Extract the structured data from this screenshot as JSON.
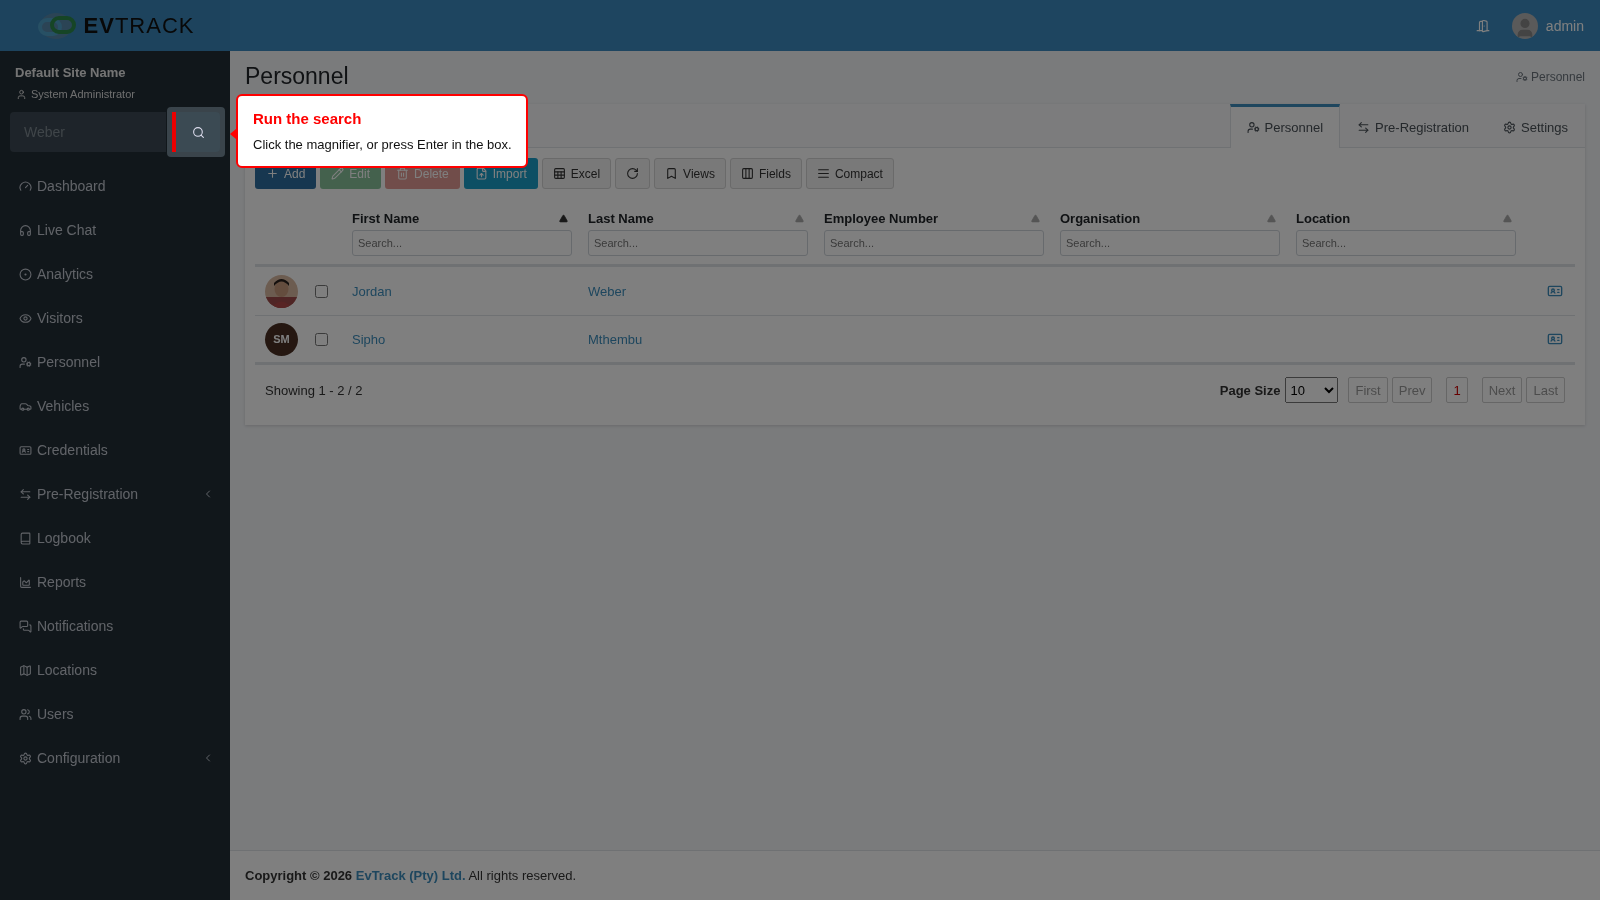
{
  "brand": {
    "logo": "**EV**TRACK"
  },
  "topbar": {
    "user": "admin"
  },
  "sidebar": {
    "site_name": "Default Site Name",
    "role": "System Administrator",
    "search": {
      "value": "Weber"
    },
    "items": [
      {
        "label": "Dashboard",
        "expandable": false
      },
      {
        "label": "Live Chat",
        "expandable": false
      },
      {
        "label": "Analytics",
        "expandable": false
      },
      {
        "label": "Visitors",
        "expandable": false
      },
      {
        "label": "Personnel",
        "expandable": false
      },
      {
        "label": "Vehicles",
        "expandable": false
      },
      {
        "label": "Credentials",
        "expandable": false
      },
      {
        "label": "Pre-Registration",
        "expandable": true
      },
      {
        "label": "Logbook",
        "expandable": false
      },
      {
        "label": "Reports",
        "expandable": false
      },
      {
        "label": "Notifications",
        "expandable": false
      },
      {
        "label": "Locations",
        "expandable": false
      },
      {
        "label": "Users",
        "expandable": false
      },
      {
        "label": "Configuration",
        "expandable": true
      }
    ]
  },
  "page": {
    "title": "Personnel",
    "breadcrumb": "Personnel"
  },
  "tabs": [
    {
      "label": "Personnel",
      "selected": true
    },
    {
      "label": "Pre-Registration",
      "selected": false
    },
    {
      "label": "Settings",
      "selected": false
    }
  ],
  "toolbar": [
    {
      "kind": "primary",
      "label": "Add",
      "disabled": false
    },
    {
      "kind": "success",
      "label": "Edit",
      "disabled": true
    },
    {
      "kind": "danger",
      "label": "Delete",
      "disabled": true
    },
    {
      "kind": "info",
      "label": "Import",
      "disabled": false
    },
    {
      "kind": "default",
      "label": "Excel",
      "disabled": false
    },
    {
      "kind": "default",
      "disabled": false
    },
    {
      "kind": "default",
      "label": "Views",
      "disabled": false
    },
    {
      "kind": "default",
      "label": "Fields",
      "disabled": false
    },
    {
      "kind": "default",
      "label": "Compact",
      "disabled": false
    }
  ],
  "table": {
    "columns": [
      {
        "label": "First Name",
        "sorted": true,
        "placeholder": "Search..."
      },
      {
        "label": "Last Name",
        "sorted": false,
        "placeholder": "Search..."
      },
      {
        "label": "Employee Number",
        "sorted": false,
        "placeholder": "Search..."
      },
      {
        "label": "Organisation",
        "sorted": false,
        "placeholder": "Search..."
      },
      {
        "label": "Location",
        "sorted": false,
        "placeholder": "Search..."
      }
    ],
    "rows": [
      {
        "checked": false,
        "first_name": "Jordan",
        "last_name": "Weber"
      },
      {
        "avatar": {
          "kind": "initials",
          "text": "SM"
        },
        "checked": false,
        "first_name": "Sipho",
        "last_name": "Mthembu"
      }
    ]
  },
  "pagination": {
    "summary": "Showing 1 - 2 / 2",
    "page_size_label": "Page Size",
    "page_size": "10",
    "pages": [
      {
        "label": "First",
        "selected": false
      },
      {
        "label": "Prev",
        "selected": false
      },
      {
        "label": "1",
        "selected": true
      },
      {
        "label": "Next",
        "selected": false
      },
      {
        "label": "Last",
        "selected": false
      }
    ]
  },
  "footer": {
    "prefix": "**Copyright © 2026**",
    "link": "EvTrack (Pty) Ltd.",
    "suffix": "All rights reserved."
  },
  "tour": {
    "title": "Run the search",
    "text": "Click the magnifier, or press Enter in the box."
  }
}
